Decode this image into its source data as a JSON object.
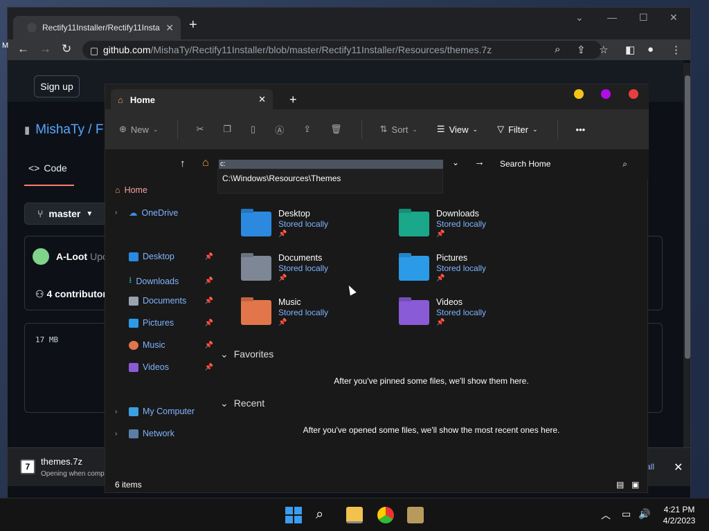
{
  "browser": {
    "tab_title": "Rectify11Installer/Rectify11Instal",
    "url_host": "github.com",
    "url_path": "/MishaTy/Rectify11Installer/blob/master/Rectify11Installer/Resources/themes.7z"
  },
  "github": {
    "signup": "Sign up",
    "repo": "MishaTy / F",
    "code_tab": "Code",
    "branch": "master",
    "commit_author": "A-Loot",
    "commit_msg": "Upo",
    "contributors": "4 contributor",
    "file_size": "17 MB",
    "side_letter": "M"
  },
  "download": {
    "file": "themes.7z",
    "status": "Opening when comp",
    "show_all": "all"
  },
  "explorer": {
    "tab_title": "Home",
    "toolbar": {
      "new": "New",
      "sort": "Sort",
      "view": "View",
      "filter": "Filter",
      "more": "•••"
    },
    "address_input": "c:",
    "suggestion": "C:\\Windows\\Resources\\Themes",
    "search_placeholder": "Search Home",
    "nav": {
      "home": "Home",
      "onedrive": "OneDrive",
      "desktop": "Desktop",
      "downloads": "Downloads",
      "documents": "Documents",
      "pictures": "Pictures",
      "music": "Music",
      "videos": "Videos",
      "my_computer": "My Computer",
      "network": "Network"
    },
    "folders": [
      {
        "name": "Desktop",
        "sub": "Stored locally",
        "color": "#2b8ae0"
      },
      {
        "name": "Downloads",
        "sub": "Stored locally",
        "color": "#1aa78a"
      },
      {
        "name": "Documents",
        "sub": "Stored locally",
        "color": "#7d8796"
      },
      {
        "name": "Pictures",
        "sub": "Stored locally",
        "color": "#2b9be8"
      },
      {
        "name": "Music",
        "sub": "Stored locally",
        "color": "#e2764a"
      },
      {
        "name": "Videos",
        "sub": "Stored locally",
        "color": "#8a5bd6"
      }
    ],
    "favorites_title": "Favorites",
    "favorites_msg": "After you've pinned some files, we'll show them here.",
    "recent_title": "Recent",
    "recent_msg": "After you've opened some files, we'll show the most recent ones here.",
    "status": "6 items"
  },
  "taskbar": {
    "time": "4:21 PM",
    "date": "4/2/2023"
  },
  "colors": {
    "link_blue": "#7fb4ff",
    "dot_yellow": "#f4c418",
    "dot_purple": "#b10be8",
    "dot_red": "#e93e3e"
  }
}
